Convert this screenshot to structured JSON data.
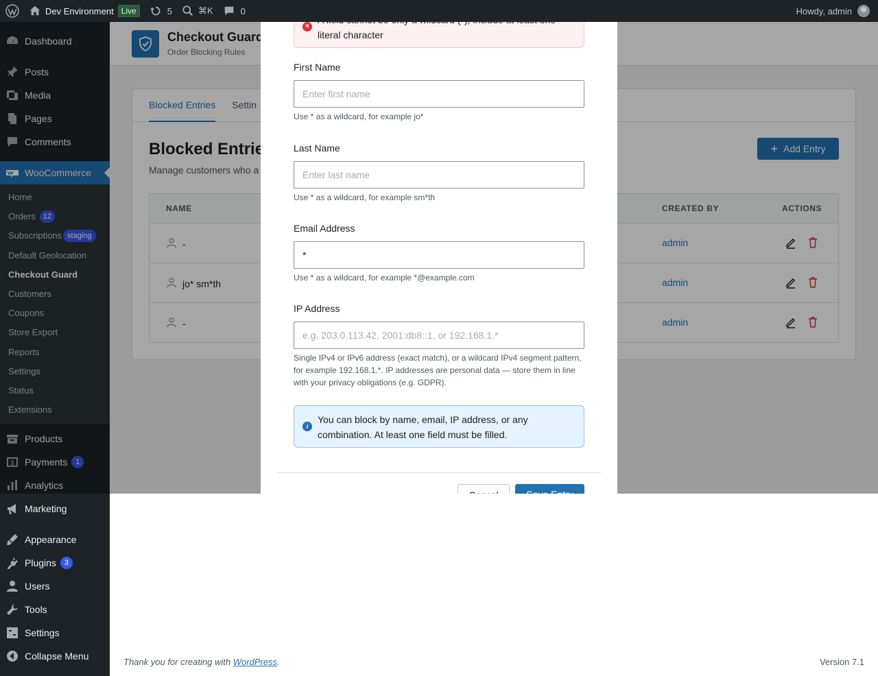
{
  "adminbar": {
    "site_name": "Dev Environment",
    "live_badge": "Live",
    "updates_count": "5",
    "search_shortcut": "⌘K",
    "comments_count": "0",
    "greeting": "Howdy, admin"
  },
  "sidebar": {
    "dashboard": "Dashboard",
    "posts": "Posts",
    "media": "Media",
    "pages": "Pages",
    "comments": "Comments",
    "woocommerce": "WooCommerce",
    "woo_submenu": {
      "home": "Home",
      "orders": "Orders",
      "orders_badge": "12",
      "subscriptions": "Subscriptions",
      "subscriptions_badge": "staging",
      "default_geolocation": "Default Geolocation",
      "checkout_guard": "Checkout Guard",
      "customers": "Customers",
      "coupons": "Coupons",
      "store_export": "Store Export",
      "reports": "Reports",
      "settings": "Settings",
      "status": "Status",
      "extensions": "Extensions"
    },
    "products": "Products",
    "payments": "Payments",
    "payments_badge": "1",
    "analytics": "Analytics",
    "marketing": "Marketing",
    "appearance": "Appearance",
    "plugins": "Plugins",
    "plugins_badge": "3",
    "users": "Users",
    "tools": "Tools",
    "settings": "Settings",
    "collapse": "Collapse Menu"
  },
  "page": {
    "title": "Checkout Guard",
    "subtitle": "Order Blocking Rules",
    "tabs": [
      "Blocked Entries",
      "Settin"
    ],
    "section_title": "Blocked Entries",
    "section_desc": "Manage customers who a",
    "add_button": "Add Entry",
    "table": {
      "headers": {
        "name": "NAME",
        "created_by": "CREATED BY",
        "actions": "ACTIONS"
      },
      "rows": [
        {
          "name": "-",
          "created_by": "admin"
        },
        {
          "name": "jo* sm*th",
          "created_by": "admin"
        },
        {
          "name": "-",
          "created_by": "admin"
        }
      ]
    }
  },
  "modal": {
    "error": "A field cannot be only a wildcard (*); include at least one literal character",
    "first_name": {
      "label": "First Name",
      "placeholder": "Enter first name",
      "help": "Use * as a wildcard, for example jo*"
    },
    "last_name": {
      "label": "Last Name",
      "placeholder": "Enter last name",
      "help": "Use * as a wildcard, for example sm*th"
    },
    "email": {
      "label": "Email Address",
      "value": "*",
      "help": "Use * as a wildcard, for example *@example.com"
    },
    "ip": {
      "label": "IP Address",
      "placeholder": "e.g. 203.0.113.42, 2001:db8::1, or 192.168.1.*",
      "help": "Single IPv4 or IPv6 address (exact match), or a wildcard IPv4 segment pattern, for example 192.168.1.*. IP addresses are personal data — store them in line with your privacy obligations (e.g. GDPR)."
    },
    "info": "You can block by name, email, IP address, or any combination. At least one field must be filled.",
    "cancel": "Cancel",
    "save": "Save Entry"
  },
  "footer": {
    "thanks_prefix": "Thank you for creating with ",
    "thanks_link": "WordPress",
    "thanks_suffix": ".",
    "version": "Version 7.1"
  }
}
